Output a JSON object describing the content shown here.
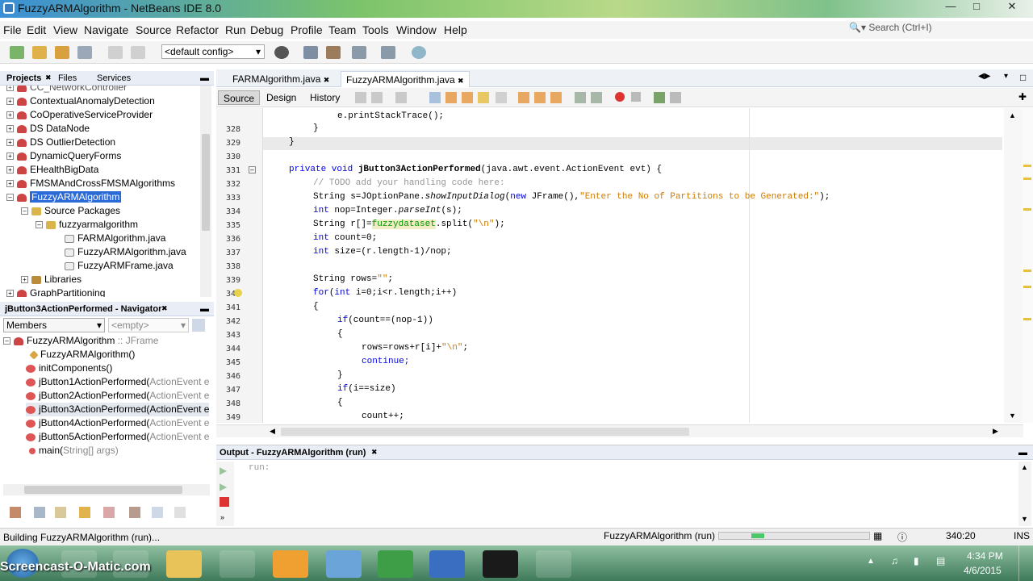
{
  "window": {
    "title": "FuzzyARMAlgorithm - NetBeans IDE 8.0"
  },
  "menu": [
    "File",
    "Edit",
    "View",
    "Navigate",
    "Source",
    "Refactor",
    "Run",
    "Debug",
    "Profile",
    "Team",
    "Tools",
    "Window",
    "Help"
  ],
  "search": {
    "placeholder": "Search (Ctrl+I)"
  },
  "toolbar": {
    "config": "<default config>"
  },
  "projects": {
    "tabs": [
      "Projects",
      "Files",
      "Services"
    ],
    "cut_item": "CC_NetworkController",
    "items": [
      "ContextualAnomalyDetection",
      "CoOperativeServiceProvider",
      "DS DataNode",
      "DS OutlierDetection",
      "DynamicQueryForms",
      "EHealthBigData",
      "FMSMAndCrossFMSMAlgorithms",
      "FuzzyARMAlgorithm"
    ],
    "source_packages": "Source Packages",
    "package": "fuzzyarmalgorithm",
    "files": [
      "FARMAlgorithm.java",
      "FuzzyARMAlgorithm.java",
      "FuzzyARMFrame.java"
    ],
    "libraries": "Libraries",
    "last": "GraphPartitioning"
  },
  "navigator": {
    "title": "jButton3ActionPerformed - Navigator",
    "members": "Members",
    "empty": "<empty>",
    "class": "FuzzyARMAlgorithm",
    "class_suffix": " :: JFrame",
    "items": [
      {
        "name": "FuzzyARMAlgorithm()",
        "param": ""
      },
      {
        "name": "initComponents()",
        "param": ""
      },
      {
        "name": "jButton1ActionPerformed(",
        "param": "ActionEvent e"
      },
      {
        "name": "jButton2ActionPerformed(",
        "param": "ActionEvent e"
      },
      {
        "name": "jButton3ActionPerformed(ActionEvent e",
        "param": ""
      },
      {
        "name": "jButton4ActionPerformed(",
        "param": "ActionEvent e"
      },
      {
        "name": "jButton5ActionPerformed(",
        "param": "ActionEvent e"
      },
      {
        "name": "main(",
        "param": "String[] args)"
      }
    ]
  },
  "editor": {
    "tabs": [
      "FARMAlgorithm.java",
      "FuzzyARMAlgorithm.java"
    ],
    "subtabs": [
      "Source",
      "Design",
      "History"
    ],
    "lines": [
      {
        "n": "328",
        "text": "}"
      },
      {
        "n": "329",
        "text": "}"
      },
      {
        "n": "330",
        "text": ""
      },
      {
        "n": "331",
        "text": "private void jButton3ActionPerformed(java.awt.event.ActionEvent evt) {"
      },
      {
        "n": "332",
        "text": "// TODO add your handling code here:"
      },
      {
        "n": "333",
        "text": "String s=JOptionPane.showInputDialog(new JFrame(),\"Enter the No of Partitions to be Generated:\");"
      },
      {
        "n": "334",
        "text": "int nop=Integer.parseInt(s);"
      },
      {
        "n": "335",
        "text": "String r[]=fuzzydataset.split(\"\\n\");"
      },
      {
        "n": "336",
        "text": "int count=0;"
      },
      {
        "n": "337",
        "text": "int size=(r.length-1)/nop;"
      },
      {
        "n": "338",
        "text": ""
      },
      {
        "n": "339",
        "text": "String rows=\"\";"
      },
      {
        "n": "340",
        "text": "for(int i=0;i<r.length;i++)"
      },
      {
        "n": "341",
        "text": "{"
      },
      {
        "n": "342",
        "text": "if(count==(nop-1))"
      },
      {
        "n": "343",
        "text": "{"
      },
      {
        "n": "344",
        "text": "rows=rows+r[i]+\"\\n\";"
      },
      {
        "n": "345",
        "text": "continue;"
      },
      {
        "n": "346",
        "text": "}"
      },
      {
        "n": "347",
        "text": "if(i==size)"
      },
      {
        "n": "348",
        "text": "{"
      },
      {
        "n": "349",
        "text": "count++;"
      }
    ],
    "top_partial": "e.printStackTrace();"
  },
  "output": {
    "title": "Output - FuzzyARMAlgorithm (run)",
    "text": "run:"
  },
  "status": {
    "left": "Building FuzzyARMAlgorithm (run)...",
    "task": "FuzzyARMAlgorithm (run)",
    "position": "340:20",
    "mode": "INS"
  },
  "taskbar": {
    "time": "4:34 PM",
    "date": "4/6/2015",
    "watermark": "Screencast-O-Matic.com"
  },
  "colors": {
    "keyword": "#0000e6",
    "comment": "#969696",
    "string": "#ce7b00",
    "selection": "#2a6ad8"
  }
}
